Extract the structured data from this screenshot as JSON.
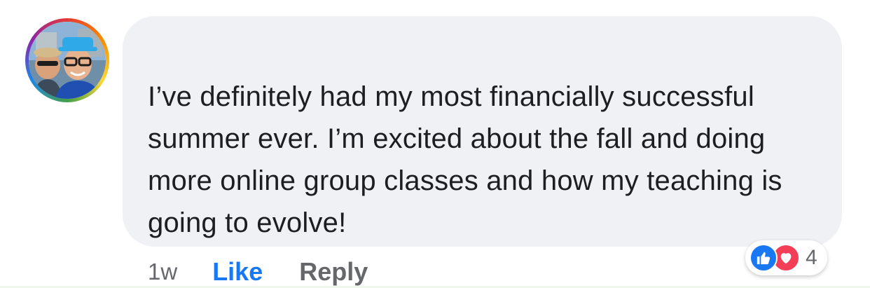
{
  "comment": {
    "text": "I’ve definitely had my most financially successful summer ever. I’m excited about the fall and doing more online group classes and how my teaching is going to evolve!"
  },
  "actions": {
    "time": "1w",
    "like_label": "Like",
    "reply_label": "Reply"
  },
  "reactions": {
    "icons": [
      "thumbs-up-icon",
      "heart-icon"
    ],
    "count": "4"
  },
  "colors": {
    "bubble": "#f0f1f4",
    "like_blue": "#1877f2",
    "love_red": "#f33e58",
    "secondary_text": "#65676b"
  }
}
